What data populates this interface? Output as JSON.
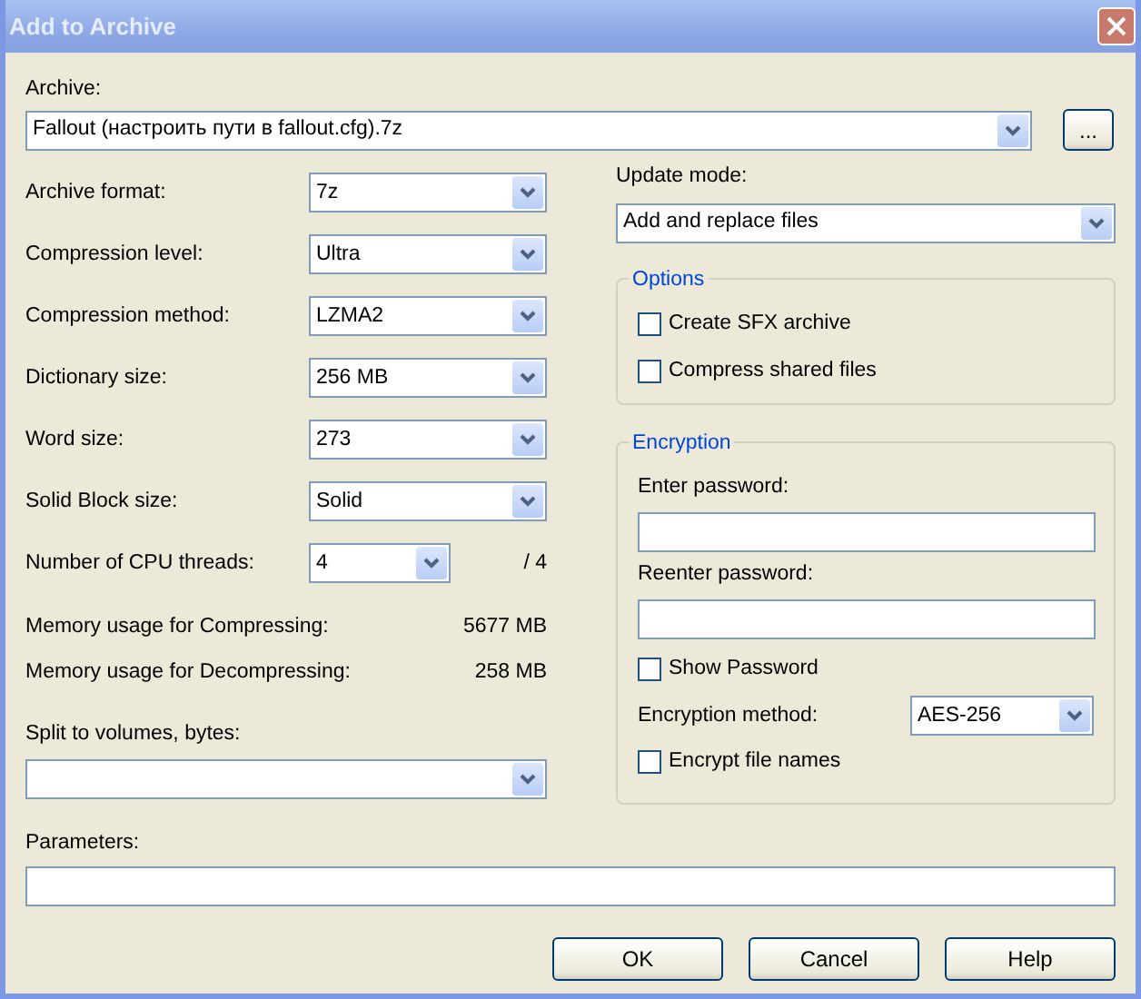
{
  "window": {
    "title": "Add to Archive"
  },
  "archive": {
    "label": "Archive:",
    "value": "Fallout (настроить пути в fallout.cfg).7z",
    "browse": "..."
  },
  "settings": [
    {
      "label": "Archive format:",
      "value": "7z"
    },
    {
      "label": "Compression level:",
      "value": "Ultra"
    },
    {
      "label": "Compression method:",
      "value": "LZMA2"
    },
    {
      "label": "Dictionary size:",
      "value": "256 MB"
    },
    {
      "label": "Word size:",
      "value": "273"
    },
    {
      "label": "Solid Block size:",
      "value": "Solid"
    },
    {
      "label": "Number of CPU threads:",
      "value": "4",
      "suffix": "/ 4"
    }
  ],
  "memory": [
    {
      "label": "Memory usage for Compressing:",
      "value": "5677 MB"
    },
    {
      "label": "Memory usage for Decompressing:",
      "value": "258 MB"
    }
  ],
  "split": {
    "label": "Split to volumes, bytes:"
  },
  "parameters": {
    "label": "Parameters:"
  },
  "update_mode": {
    "label": "Update mode:",
    "value": "Add and replace files"
  },
  "options": {
    "title": "Options",
    "checkboxes": [
      {
        "label": "Create SFX archive",
        "checked": false
      },
      {
        "label": "Compress shared files",
        "checked": false
      }
    ]
  },
  "encryption": {
    "title": "Encryption",
    "fields": [
      {
        "label": "Enter password:"
      },
      {
        "label": "Reenter password:"
      }
    ],
    "show_password": {
      "label": "Show Password",
      "checked": false
    },
    "method": {
      "label": "Encryption method:",
      "value": "AES-256"
    },
    "encrypt_names": {
      "label": "Encrypt file names",
      "checked": false
    }
  },
  "buttons": [
    "OK",
    "Cancel",
    "Help"
  ]
}
